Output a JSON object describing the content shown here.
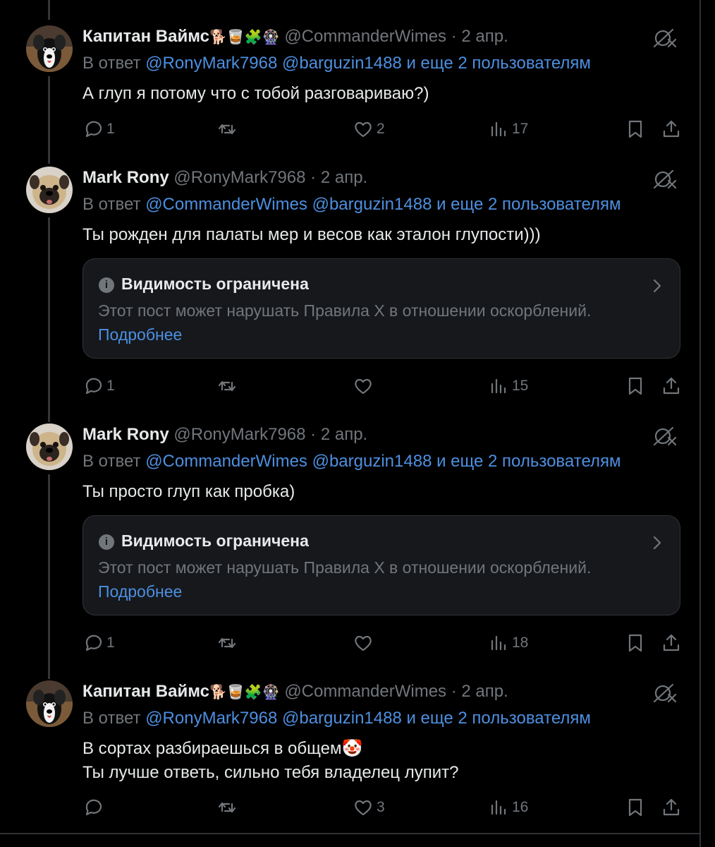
{
  "tweets": [
    {
      "name": "Капитан Ваймс",
      "emojis": "🐕🥃🧩🎡",
      "handle": "@CommanderWimes",
      "date": "· 2 апр.",
      "reply_prefix": "В ответ",
      "reply_to": [
        "@RonyMark7968",
        "@barguzin1488"
      ],
      "reply_more": "и еще 2 пользователям",
      "lines": [
        "А глуп я потому что с тобой разговариваю?)"
      ],
      "replies": "1",
      "retweets": "",
      "likes": "2",
      "views": "17"
    },
    {
      "name": "Mark Rony",
      "handle": "@RonyMark7968",
      "date": "· 2 апр.",
      "reply_prefix": "В ответ",
      "reply_to": [
        "@CommanderWimes",
        "@barguzin1488"
      ],
      "reply_more": "и еще 2 пользователям",
      "lines": [
        "Ты рожден для палаты мер и весов как эталон глупости)))"
      ],
      "notice": {
        "title": "Видимость ограничена",
        "text": "Этот пост может нарушать Правила X в отношении оскорблений.",
        "link": "Подробнее"
      },
      "replies": "1",
      "retweets": "",
      "likes": "",
      "views": "15"
    },
    {
      "name": "Mark Rony",
      "handle": "@RonyMark7968",
      "date": "· 2 апр.",
      "reply_prefix": "В ответ",
      "reply_to": [
        "@CommanderWimes",
        "@barguzin1488"
      ],
      "reply_more": "и еще 2 пользователям",
      "lines": [
        "Ты просто глуп как пробка)"
      ],
      "notice": {
        "title": "Видимость ограничена",
        "text": "Этот пост может нарушать Правила X в отношении оскорблений.",
        "link": "Подробнее"
      },
      "replies": "1",
      "retweets": "",
      "likes": "",
      "views": "18"
    },
    {
      "name": "Капитан Ваймс",
      "emojis": "🐕🥃🧩🎡",
      "handle": "@CommanderWimes",
      "date": "· 2 апр.",
      "reply_prefix": "В ответ",
      "reply_to": [
        "@RonyMark7968",
        "@barguzin1488"
      ],
      "reply_more": "и еще 2 пользователям",
      "lines": [
        "В сортах разбираешься в общем🤡",
        "Ты лучше ответь, сильно тебя владелец лупит?"
      ],
      "replies": "",
      "retweets": "",
      "likes": "3",
      "views": "16"
    }
  ],
  "colors": {
    "background": "#000000",
    "text": "#e7e9ea",
    "muted": "#71767b",
    "link": "#4d8fe0",
    "card": "#16181c"
  },
  "icons": [
    "reply-icon",
    "retweet-icon",
    "like-icon",
    "views-icon",
    "bookmark-icon",
    "share-icon",
    "mute-icon",
    "info-icon",
    "chevron-right-icon"
  ]
}
